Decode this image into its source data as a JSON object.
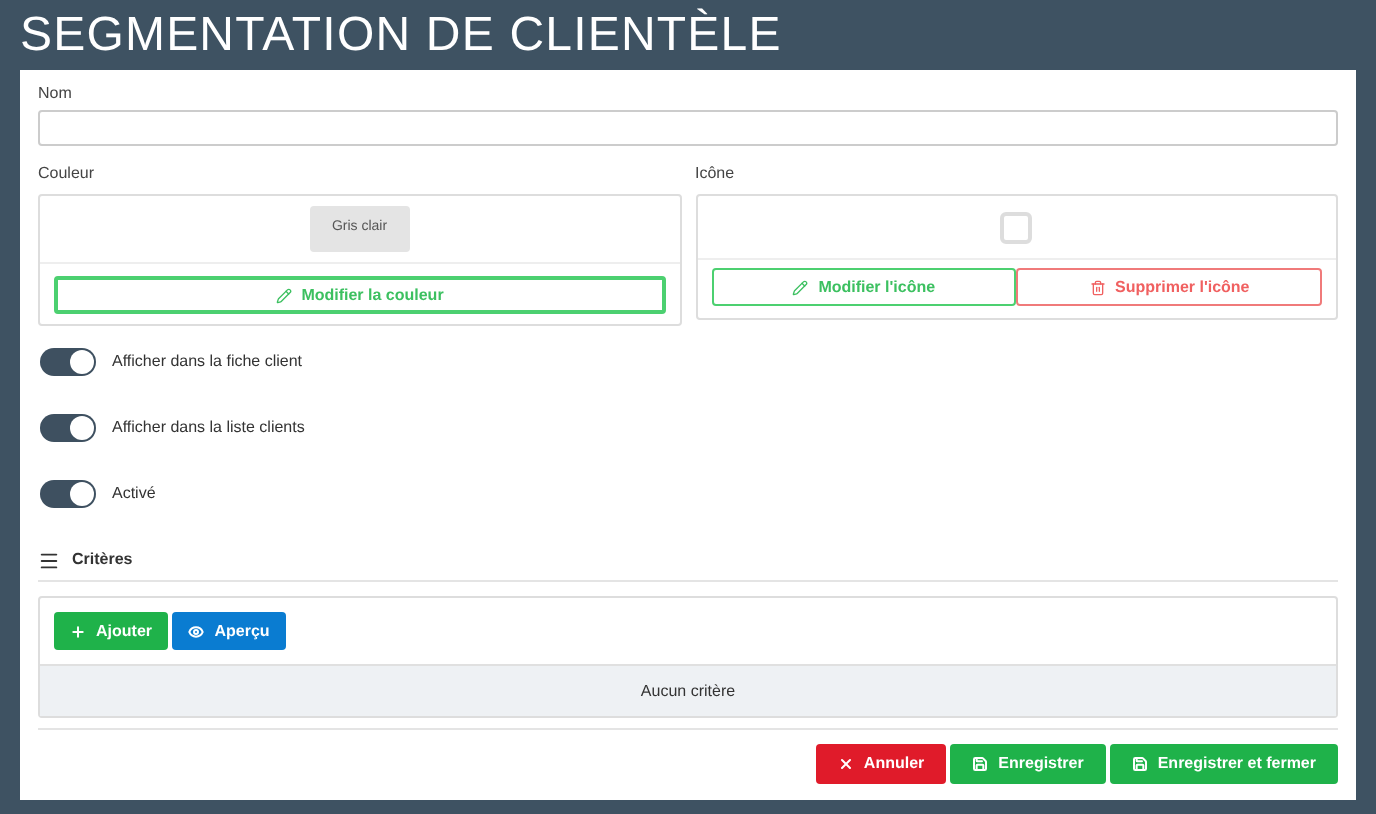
{
  "title": "SEGMENTATION DE CLIENTÈLE",
  "name_field": {
    "label": "Nom"
  },
  "color": {
    "label": "Couleur",
    "swatch": "Gris clair",
    "button": "Modifier la couleur"
  },
  "icon": {
    "label": "Icône",
    "buttons": [
      {
        "label": "Modifier l'icône",
        "kind": "edit"
      },
      {
        "label": "Supprimer l'icône",
        "kind": "delete"
      }
    ]
  },
  "toggles": [
    {
      "label": "Afficher dans la fiche client",
      "on": true
    },
    {
      "label": "Afficher dans la liste clients",
      "on": true
    },
    {
      "label": "Activé",
      "on": true
    }
  ],
  "criteria": {
    "title": "Critères",
    "buttons": [
      {
        "label": "Ajouter",
        "kind": "add"
      },
      {
        "label": "Aperçu",
        "kind": "preview"
      }
    ],
    "empty": "Aucun critère"
  },
  "footer": [
    {
      "label": "Annuler",
      "kind": "cancel"
    },
    {
      "label": "Enregistrer",
      "kind": "save"
    },
    {
      "label": "Enregistrer et fermer",
      "kind": "save"
    }
  ]
}
